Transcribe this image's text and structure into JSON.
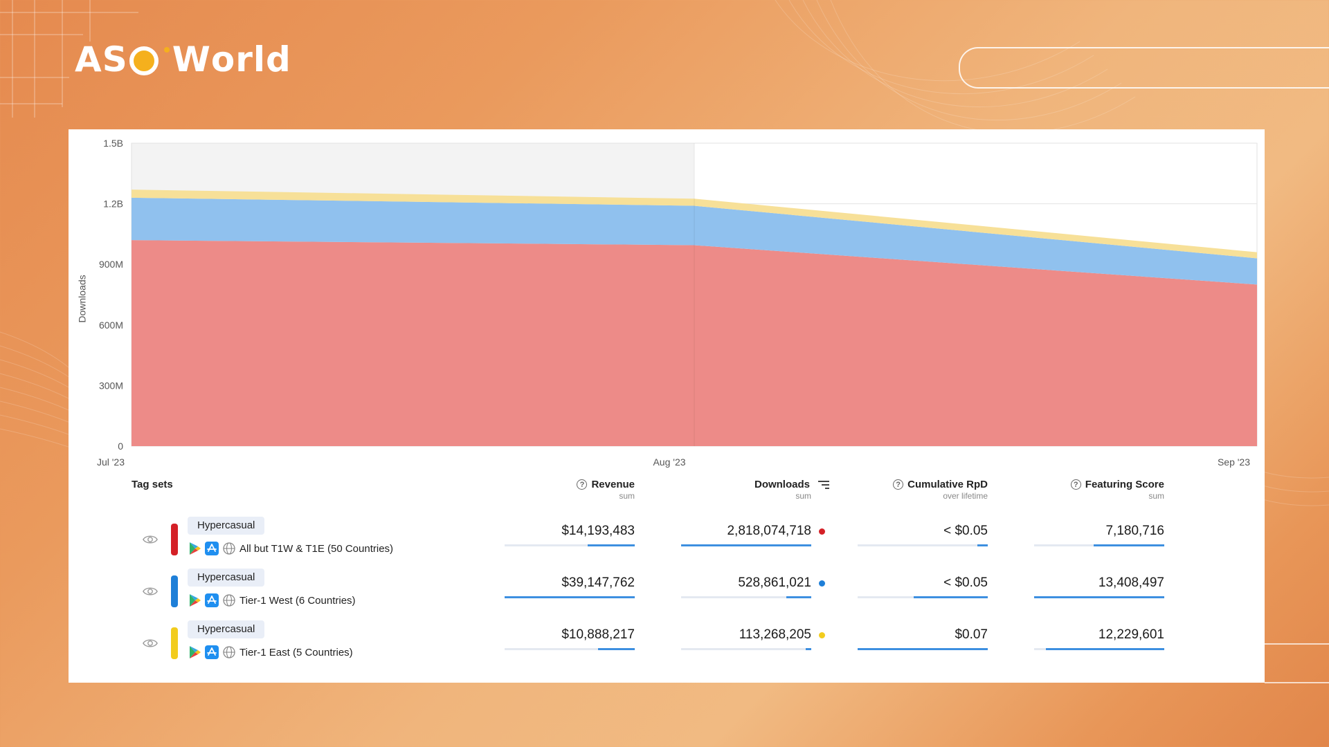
{
  "brand": {
    "logo_parts": [
      "AS",
      "W",
      "orld"
    ],
    "logo_accent": "#f5b01d"
  },
  "chart_data": {
    "type": "area",
    "stacked": true,
    "x": [
      "Jul '23",
      "Aug '23",
      "Sep '23"
    ],
    "ylabel": "Downloads",
    "ylim": [
      0,
      1500000000
    ],
    "y_ticks": [
      0,
      300000000,
      600000000,
      900000000,
      1200000000,
      1500000000
    ],
    "y_tick_labels": [
      "0",
      "300M",
      "600M",
      "900M",
      "1.2B",
      "1.5B"
    ],
    "grid": true,
    "series": [
      {
        "color": "#ed8b88",
        "values": [
          1020000000,
          995000000,
          800000000
        ]
      },
      {
        "color": "#90c1ee",
        "values": [
          210000000,
          195000000,
          130000000
        ]
      },
      {
        "color": "#f7e098",
        "values": [
          40000000,
          35000000,
          30000000
        ]
      }
    ],
    "shaded_range": [
      "Jul '23",
      "Aug '23"
    ]
  },
  "table": {
    "tag_sets_label": "Tag sets",
    "columns": [
      {
        "label": "Revenue",
        "sub": "sum",
        "help": true
      },
      {
        "label": "Downloads",
        "sub": "sum",
        "sort": true
      },
      {
        "label": "Cumulative RpD",
        "sub": "over lifetime",
        "help": true
      },
      {
        "label": "Featuring Score",
        "sub": "sum",
        "help": true
      }
    ],
    "rows": [
      {
        "color": "#d42027",
        "chip": "Hypercasual",
        "name": "All but T1W & T1E (50 Countries)",
        "revenue": "$14,193,483",
        "downloads": "2,818,074,718",
        "rpd": "< $0.05",
        "featuring": "7,180,716",
        "fills": [
          0.36,
          1.0,
          0.08,
          0.54
        ]
      },
      {
        "color": "#1e7fd8",
        "chip": "Hypercasual",
        "name": "Tier-1 West (6 Countries)",
        "revenue": "$39,147,762",
        "downloads": "528,861,021",
        "rpd": "< $0.05",
        "featuring": "13,408,497",
        "fills": [
          1.0,
          0.19,
          0.57,
          1.0
        ]
      },
      {
        "color": "#f2cc1d",
        "chip": "Hypercasual",
        "name": "Tier-1 East (5 Countries)",
        "revenue": "$10,888,217",
        "downloads": "113,268,205",
        "rpd": "$0.07",
        "featuring": "12,229,601",
        "fills": [
          0.28,
          0.04,
          1.0,
          0.91
        ]
      }
    ]
  }
}
